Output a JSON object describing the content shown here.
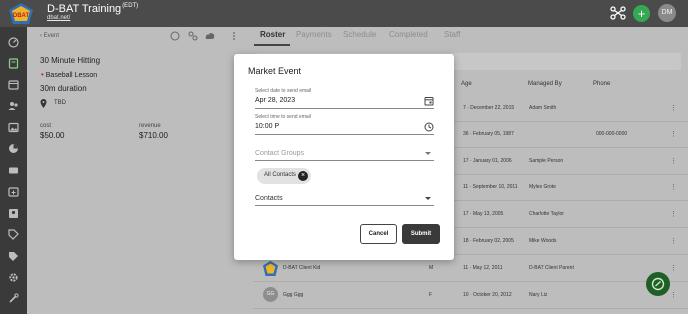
{
  "header": {
    "title": "D-BAT Training",
    "timezone": "(EDT)",
    "link": "dbat.net/",
    "avatar_initials": "DM",
    "add_label": "+"
  },
  "event": {
    "back_label": "Event",
    "name": "30 Minute Hitting",
    "type": "Baseball Lesson",
    "duration": "30m duration",
    "location": "TBD",
    "cost_label": "cost",
    "cost_value": "$50.00",
    "revenue_label": "revenue",
    "revenue_value": "$710.00"
  },
  "tabs": [
    "Roster",
    "Payments",
    "Schedule",
    "Completed",
    "Staff"
  ],
  "table": {
    "headers": {
      "age": "Age",
      "managed_by": "Managed By",
      "phone": "Phone"
    },
    "rows": [
      {
        "name": "",
        "gender": "",
        "age": "7 · December 22, 2015",
        "managed_by": "Adam Smith",
        "phone": ""
      },
      {
        "name": "",
        "gender": "",
        "age": "36 · February 05, 1987",
        "managed_by": "",
        "phone": "000-000-0000"
      },
      {
        "name": "",
        "gender": "",
        "age": "17 · January 01, 2006",
        "managed_by": "Sample Person",
        "phone": ""
      },
      {
        "name": "",
        "gender": "",
        "age": "11 · September 10, 2011",
        "managed_by": "Myles Grote",
        "phone": ""
      },
      {
        "name": "",
        "gender": "",
        "age": "17 · May 13, 2005",
        "managed_by": "Charlotte Taylor",
        "phone": ""
      },
      {
        "name": "",
        "gender": "",
        "age": "18 · February 02, 2005",
        "managed_by": "Mike Woods",
        "phone": ""
      },
      {
        "name": "D-BAT Client Kid",
        "gender": "M",
        "age": "11 · May 12, 2011",
        "managed_by": "D-BAT Client Parent",
        "phone": ""
      },
      {
        "name": "Ggg Ggg",
        "gender": "F",
        "age": "10 · October 20, 2012",
        "managed_by": "Nary Liz",
        "phone": "",
        "avatar": "GG"
      }
    ],
    "row_menu": "⋮"
  },
  "modal": {
    "title": "Market Event",
    "date_label": "Select date to send email",
    "date_value": "Apr 28, 2023",
    "time_label": "Select time to send email",
    "time_value": "10:00 P",
    "contact_groups_placeholder": "Contact Groups",
    "chip_label": "All Contacts",
    "contacts_label": "Contacts",
    "cancel_label": "Cancel",
    "submit_label": "Submit"
  },
  "colors": {
    "header_bg": "#4b4b4b",
    "sidebar_bg": "#3a3a3a",
    "accent_green": "#34a853",
    "submit_bg": "#3a3a3a"
  },
  "icons": {
    "sidebar": [
      "dashboard-icon",
      "book-icon",
      "calendar-icon",
      "people-icon",
      "image-icon",
      "chart-icon",
      "ticket-icon",
      "calendar-add-icon",
      "contact-card-icon",
      "tag-icon",
      "tag-alt-icon",
      "settings-icon",
      "tools-icon"
    ]
  }
}
